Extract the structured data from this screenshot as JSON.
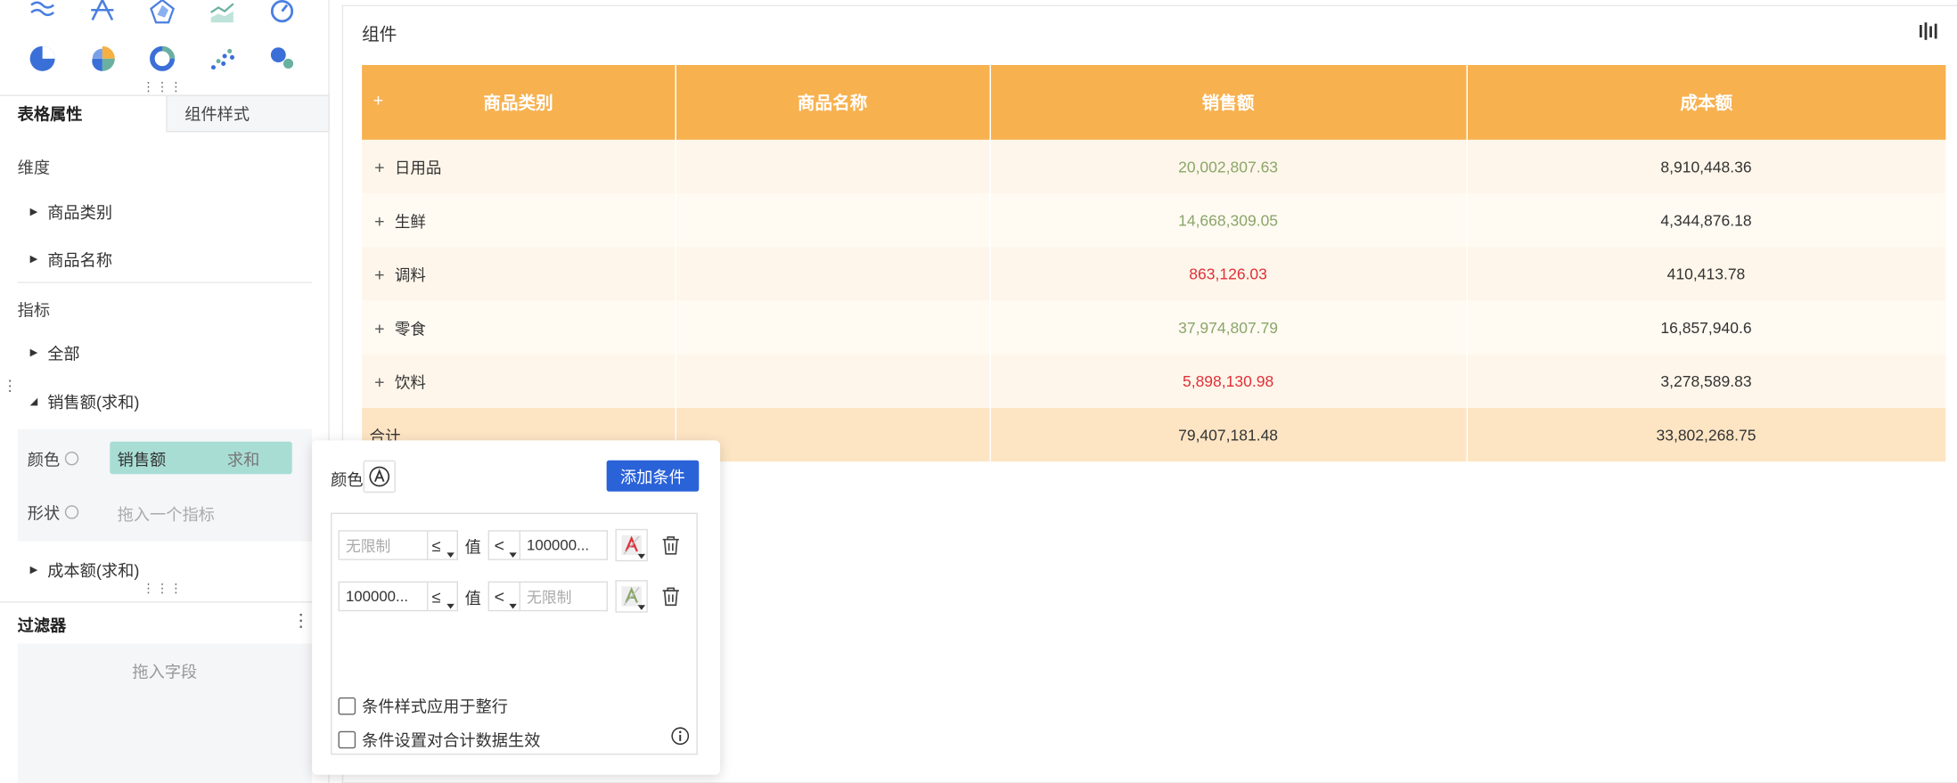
{
  "left_panel": {
    "chart_icons_row1": [
      "wave-chart-icon",
      "star-line-icon",
      "radar-icon",
      "area-line-icon",
      "gauge-icon"
    ],
    "chart_icons_row2": [
      "pie-icon",
      "rose-pie-icon",
      "ring-icon",
      "scatter-icon",
      "bubble-icon"
    ],
    "tabs": {
      "active": "表格属性",
      "inactive": "组件样式"
    },
    "dimension_label": "维度",
    "dimensions": [
      "商品类别",
      "商品名称"
    ],
    "metric_label": "指标",
    "metrics": {
      "all": "全部",
      "sales": "销售额(求和)",
      "cost": "成本额(求和)"
    },
    "attrs": {
      "color_label": "颜色",
      "color_pill_field": "销售额",
      "color_pill_agg": "求和",
      "shape_label": "形状",
      "shape_placeholder": "拖入一个指标"
    },
    "filter": {
      "title": "过滤器",
      "more": "⋮",
      "hint": "拖入字段"
    }
  },
  "component": {
    "title": "组件",
    "headers": [
      "商品类别",
      "商品名称",
      "销售额",
      "成本额"
    ],
    "rows": [
      {
        "category": "日用品",
        "sales": "20,002,807.63",
        "cost": "8,910,448.36",
        "sales_color": "green"
      },
      {
        "category": "生鲜",
        "sales": "14,668,309.05",
        "cost": "4,344,876.18",
        "sales_color": "green"
      },
      {
        "category": "调料",
        "sales": "863,126.03",
        "cost": "410,413.78",
        "sales_color": "red"
      },
      {
        "category": "零食",
        "sales": "37,974,807.79",
        "cost": "16,857,940.6",
        "sales_color": "green"
      },
      {
        "category": "饮料",
        "sales": "5,898,130.98",
        "cost": "3,278,589.83",
        "sales_color": "red"
      }
    ],
    "total": {
      "label": "合计",
      "sales": "79,407,181.48",
      "cost": "33,802,268.75"
    },
    "colors": {
      "header": "#f7b14f",
      "green": "#8aa66a",
      "red": "#e0303a"
    }
  },
  "popup": {
    "color_label": "颜色",
    "add_button": "添加条件",
    "rules": [
      {
        "left_value": "无限制",
        "left_placeholder": true,
        "left_op": "≤",
        "value_label": "值",
        "right_op": "<",
        "right_value": "100000...",
        "right_placeholder": false,
        "style_color": "#e0303a"
      },
      {
        "left_value": "100000...",
        "left_placeholder": false,
        "left_op": "≤",
        "value_label": "值",
        "right_op": "<",
        "right_value": "无限制",
        "right_placeholder": true,
        "style_color": "#8aa66a"
      }
    ],
    "checkbox_row": "条件样式应用于整行",
    "checkbox_total": "条件设置对合计数据生效"
  }
}
